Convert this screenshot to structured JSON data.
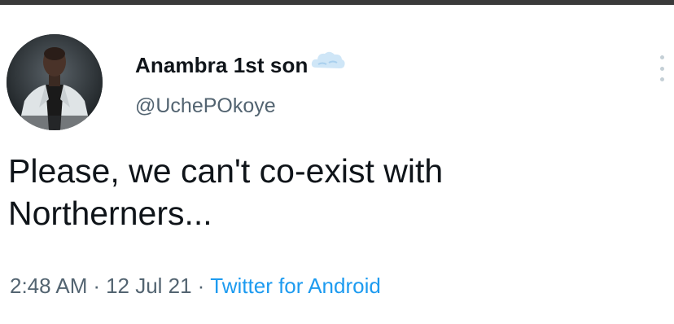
{
  "tweet": {
    "author": {
      "display_name": "Anambra 1st son",
      "handle": "@UchePOkoye",
      "badge_emoji": "cloud-emoji"
    },
    "text_lines": [
      "Please, we can't co-exist with",
      "Northerners..."
    ],
    "meta": {
      "time": "2:48 AM",
      "separator": "·",
      "date": "12 Jul 21",
      "source": "Twitter for Android"
    }
  },
  "icons": {
    "more": "more-options-icon",
    "avatar": "profile-avatar"
  },
  "colors": {
    "text_primary": "#0f1419",
    "text_secondary": "#536471",
    "link": "#1d9bf0",
    "background": "#ffffff"
  }
}
